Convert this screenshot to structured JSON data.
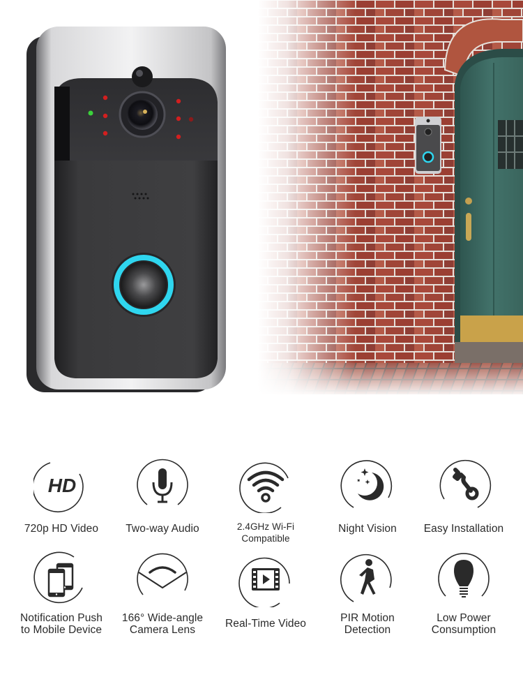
{
  "product": {
    "name": "Video Doorbell",
    "accent_ring_color": "#2fd6ef",
    "body_color": "#3b3b3d",
    "trim_color": "#c9c9cb",
    "ir_led_color": "#d21f1f",
    "status_led_color": "#3bd13b"
  },
  "scene": {
    "brick_color": "#a5493c",
    "mortar_color": "#e9e4de",
    "door_color": "#3d6a62",
    "kick_plate_color": "#c9a24a"
  },
  "features": {
    "row1": [
      {
        "icon": "hd-icon",
        "label_line1": "720p HD Video",
        "label_line2": ""
      },
      {
        "icon": "microphone-icon",
        "label_line1": "Two-way Audio",
        "label_line2": ""
      },
      {
        "icon": "wifi-icon",
        "label_line1": "2.4GHz Wi-Fi",
        "label_line2": "Compatible"
      },
      {
        "icon": "moon-stars-icon",
        "label_line1": "Night Vision",
        "label_line2": ""
      },
      {
        "icon": "wrench-icon",
        "label_line1": "Easy Installation",
        "label_line2": ""
      }
    ],
    "row2": [
      {
        "icon": "mobile-devices-icon",
        "label_line1": "Notification Push",
        "label_line2": "to Mobile Device"
      },
      {
        "icon": "wide-angle-icon",
        "label_line1": "166° Wide-angle",
        "label_line2": "Camera Lens"
      },
      {
        "icon": "video-play-icon",
        "label_line1": "Real-Time Video",
        "label_line2": ""
      },
      {
        "icon": "walking-person-icon",
        "label_line1": "PIR Motion",
        "label_line2": "Detection"
      },
      {
        "icon": "light-bulb-icon",
        "label_line1": "Low Power",
        "label_line2": "Consumption"
      }
    ]
  }
}
